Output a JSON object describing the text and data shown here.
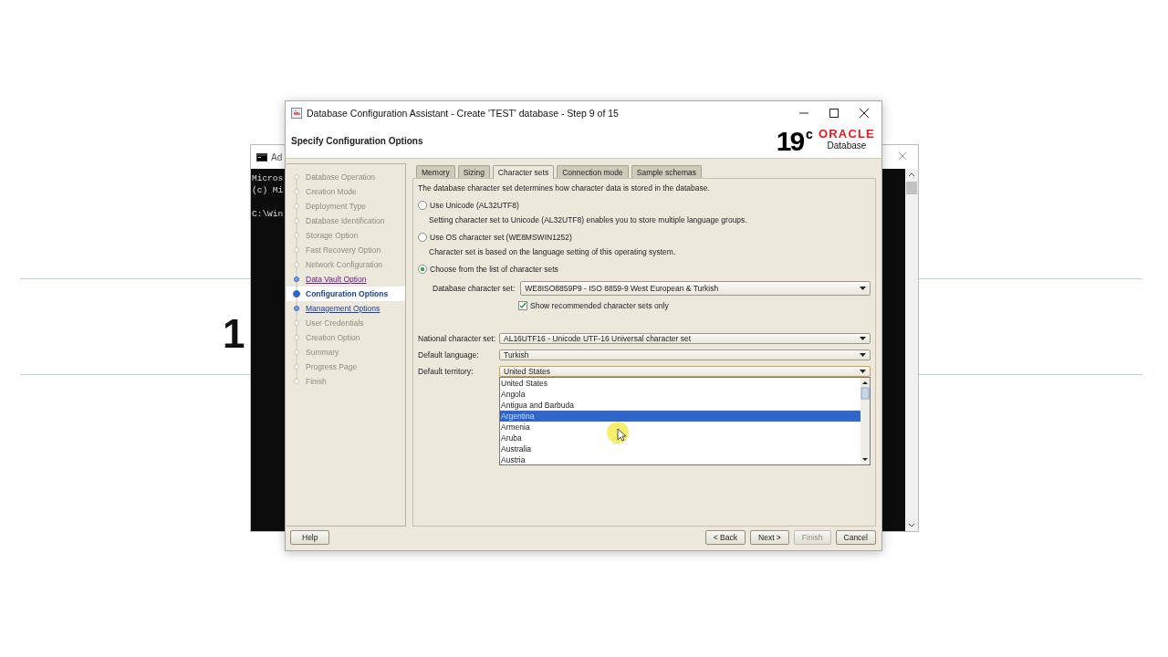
{
  "background": {
    "heading_fragment": "1"
  },
  "console": {
    "title": "Ad",
    "lines": [
      "Micros",
      "(c) Mi",
      "C:\\Win"
    ]
  },
  "dialog": {
    "title": "Database Configuration Assistant - Create 'TEST' database - Step 9 of 15",
    "header": "Specify Configuration Options",
    "logo": {
      "version": "19",
      "suffix": "c",
      "brand": "ORACLE",
      "product": "Database"
    },
    "steps": [
      {
        "label": "Database Operation",
        "disabled": true,
        "visited": false,
        "selected": false
      },
      {
        "label": "Creation Mode",
        "disabled": true,
        "visited": false,
        "selected": false
      },
      {
        "label": "Deployment Type",
        "disabled": true,
        "visited": false,
        "selected": false
      },
      {
        "label": "Database Identification",
        "disabled": true,
        "visited": false,
        "selected": false
      },
      {
        "label": "Storage Option",
        "disabled": true,
        "visited": false,
        "selected": false
      },
      {
        "label": "Fast Recovery Option",
        "disabled": true,
        "visited": false,
        "selected": false
      },
      {
        "label": "Network Configuration",
        "disabled": true,
        "visited": false,
        "selected": false
      },
      {
        "label": "Data Vault Option",
        "disabled": false,
        "visited": true,
        "selected": false
      },
      {
        "label": "Configuration Options",
        "disabled": false,
        "visited": false,
        "selected": true
      },
      {
        "label": "Management Options",
        "disabled": false,
        "visited": false,
        "selected": false
      },
      {
        "label": "User Credentials",
        "disabled": true,
        "visited": false,
        "selected": false
      },
      {
        "label": "Creation Option",
        "disabled": true,
        "visited": false,
        "selected": false
      },
      {
        "label": "Summary",
        "disabled": true,
        "visited": false,
        "selected": false
      },
      {
        "label": "Progress Page",
        "disabled": true,
        "visited": false,
        "selected": false
      },
      {
        "label": "Finish",
        "disabled": true,
        "visited": false,
        "selected": false
      }
    ],
    "tabs": [
      {
        "label": "Memory",
        "selected": false
      },
      {
        "label": "Sizing",
        "selected": false
      },
      {
        "label": "Character sets",
        "selected": true
      },
      {
        "label": "Connection mode",
        "selected": false
      },
      {
        "label": "Sample schemas",
        "selected": false
      }
    ],
    "intro": "The database character set determines how character data is stored in the database.",
    "options": [
      {
        "label": "Use Unicode (AL32UTF8)",
        "description": "Setting character set to Unicode (AL32UTF8) enables you to store multiple language groups.",
        "selected": false
      },
      {
        "label": "Use OS character set (WE8MSWIN1252)",
        "description": "Character set is based on the language setting of this operating system.",
        "selected": false
      },
      {
        "label": "Choose from the list of character sets",
        "selected": true
      }
    ],
    "database_charset": {
      "label": "Database character set:",
      "value": "WE8ISO8859P9 - ISO 8859-9 West European & Turkish"
    },
    "recommended_only": {
      "label": "Show recommended character sets only",
      "checked": true
    },
    "fields": [
      {
        "label": "National character set:",
        "value": "AL16UTF16 - Unicode UTF-16 Universal character set"
      },
      {
        "label": "Default language:",
        "value": "Turkish"
      },
      {
        "label": "Default territory:",
        "value": "United States"
      }
    ],
    "territory_list": [
      {
        "label": "United States",
        "selected": false
      },
      {
        "label": "Angola",
        "selected": false
      },
      {
        "label": "Antigua and Barbuda",
        "selected": false
      },
      {
        "label": "Argentina",
        "selected": true
      },
      {
        "label": "Armenia",
        "selected": false
      },
      {
        "label": "Aruba",
        "selected": false
      },
      {
        "label": "Australia",
        "selected": false
      },
      {
        "label": "Austria",
        "selected": false
      }
    ],
    "buttons": [
      {
        "label": "Help",
        "kind": "help",
        "disabled": false
      },
      {
        "label": "< Back",
        "kind": "nav",
        "disabled": false
      },
      {
        "label": "Next >",
        "kind": "nav",
        "disabled": false
      },
      {
        "label": "Finish",
        "kind": "nav",
        "disabled": true
      },
      {
        "label": "Cancel",
        "kind": "nav",
        "disabled": false
      }
    ]
  }
}
